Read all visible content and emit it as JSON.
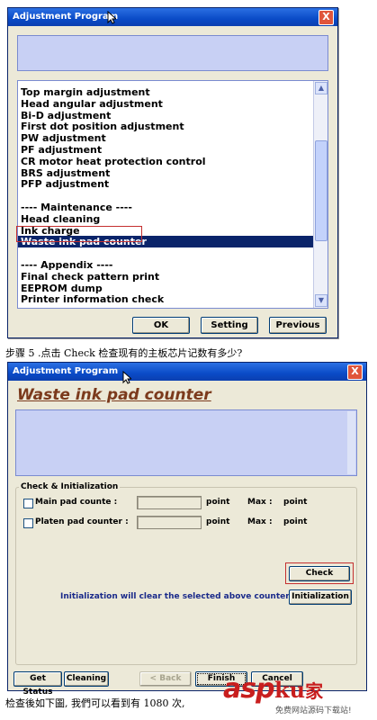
{
  "window1": {
    "title": "Adjustment Program",
    "close_label": "X",
    "list_items": [
      "Top margin adjustment",
      "Head angular adjustment",
      "Bi-D adjustment",
      "First dot position adjustment",
      "PW adjustment",
      "PF adjustment",
      "CR motor heat protection control",
      "BRS adjustment",
      "PFP adjustment",
      "",
      "---- Maintenance ----",
      "Head cleaning",
      "Ink charge",
      "Waste ink pad counter",
      "",
      "---- Appendix ----",
      "Final check pattern print",
      "EEPROM dump",
      "Printer information check"
    ],
    "selected_item": "Waste ink pad counter",
    "buttons": {
      "ok": "OK",
      "setting": "Setting",
      "previous": "Previous"
    }
  },
  "caption1": "步骤 5 .点击 Check 检查现有的主板芯片记数有多少?",
  "window2": {
    "title": "Adjustment Program",
    "close_label": "X",
    "heading": "Waste ink pad counter",
    "group_label": "Check & Initialization",
    "rows": [
      {
        "label": "Main pad counte :",
        "unit": "point",
        "max_label": "Max :",
        "max_unit": "point"
      },
      {
        "label": "Platen pad counter :",
        "unit": "point",
        "max_label": "Max :",
        "max_unit": "point"
      }
    ],
    "check_button": "Check",
    "info_text": "Initialization will clear the selected above counters.",
    "init_button": "Initialization",
    "bottom_buttons": {
      "get_status": "Get Status",
      "cleaning": "Cleaning",
      "back": "< Back",
      "finish": "Finish",
      "cancel": "Cancel"
    }
  },
  "caption2": "检查後如下圖, 我們可以看到有 1080 次,",
  "watermark": {
    "brand_asp": "asp",
    "brand_ku": "ku",
    "brand_jia": "家",
    "sub": "免费网站源码下载站!"
  }
}
